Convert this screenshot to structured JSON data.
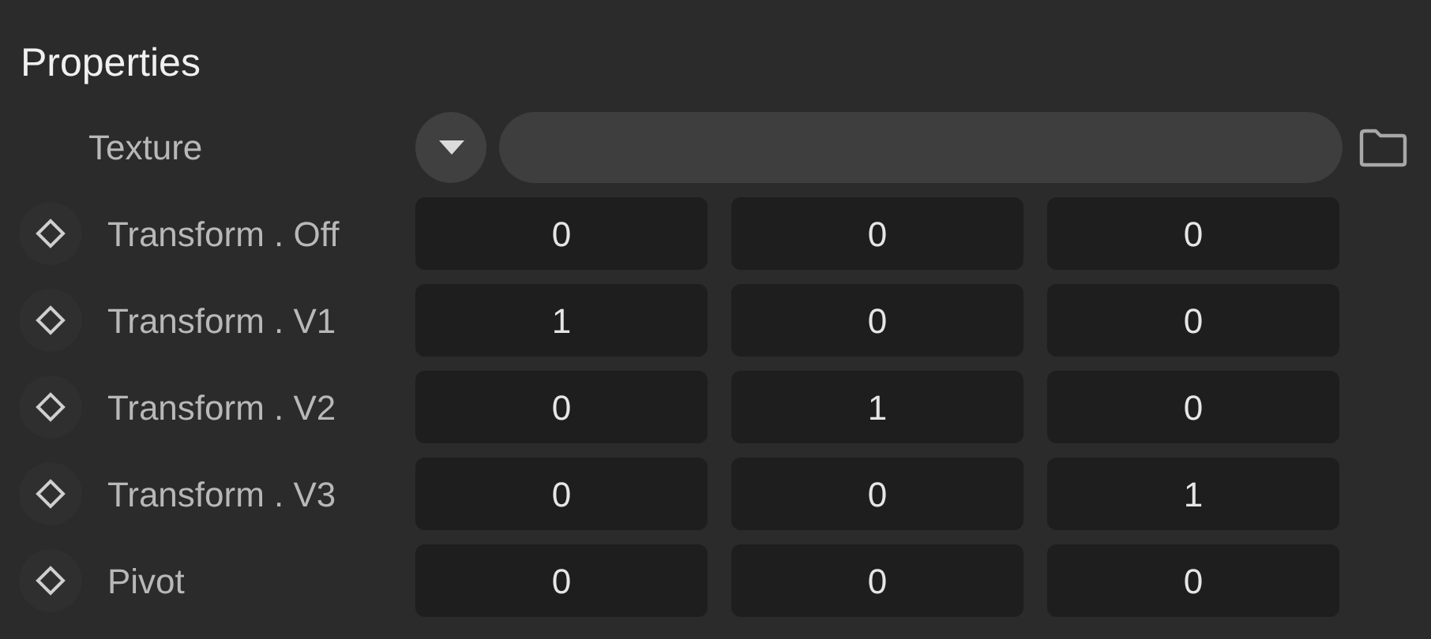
{
  "panel": {
    "title": "Properties",
    "rows": [
      {
        "kind": "texture",
        "label": "Texture"
      },
      {
        "kind": "vector",
        "label": "Transform . Off",
        "values": [
          "0",
          "0",
          "0"
        ]
      },
      {
        "kind": "vector",
        "label": "Transform . V1",
        "values": [
          "1",
          "0",
          "0"
        ]
      },
      {
        "kind": "vector",
        "label": "Transform . V2",
        "values": [
          "0",
          "1",
          "0"
        ]
      },
      {
        "kind": "vector",
        "label": "Transform . V3",
        "values": [
          "0",
          "0",
          "1"
        ]
      },
      {
        "kind": "vector",
        "label": "Pivot",
        "values": [
          "0",
          "0",
          "0"
        ]
      }
    ]
  }
}
